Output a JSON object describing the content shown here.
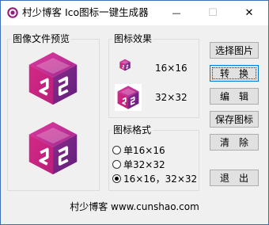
{
  "window": {
    "title": "村少博客 Ico图标一键生成器",
    "minimize_glyph": "—",
    "maximize_glyph": "☐",
    "close_glyph": "✕"
  },
  "preview_panel": {
    "title": "图像文件预览"
  },
  "effect_panel": {
    "title": "图标效果",
    "size_small_label": "16×16",
    "size_large_label": "32×32"
  },
  "format_panel": {
    "title": "图标格式",
    "options": [
      "单16×16",
      "单32×32",
      "16×16，32×32"
    ],
    "selected_index": 2
  },
  "buttons": {
    "select_image": "选择图片",
    "convert": "转　换",
    "edit": "编　辑",
    "save_icon": "保存图标",
    "clear": "清　除",
    "exit": "退　出"
  },
  "footer": {
    "text": "村少博客 www.cunshao.com"
  },
  "colors": {
    "accent": "#0078d7",
    "logo_light": "#d0237f",
    "logo_dark": "#7b1a7a"
  }
}
